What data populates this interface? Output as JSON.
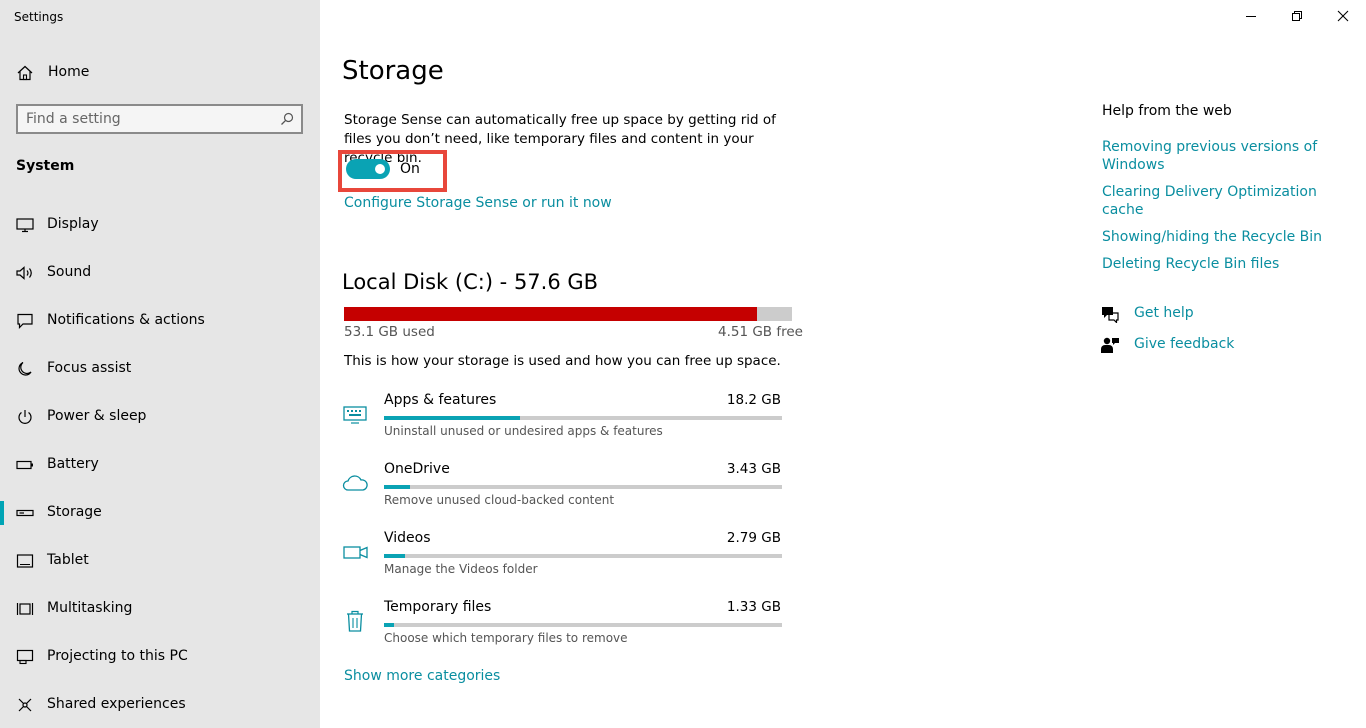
{
  "window": {
    "title": "Settings",
    "controls": [
      {
        "name": "minimize-button",
        "icon": "minimize-icon"
      },
      {
        "name": "restore-button",
        "icon": "restore-icon"
      },
      {
        "name": "close-button",
        "icon": "close-icon"
      }
    ]
  },
  "sidebar": {
    "home_label": "Home",
    "search_placeholder": "Find a setting",
    "section_label": "System",
    "items": [
      {
        "label": "Display",
        "icon": "monitor-icon",
        "active": false
      },
      {
        "label": "Sound",
        "icon": "speaker-icon",
        "active": false
      },
      {
        "label": "Notifications & actions",
        "icon": "notification-icon",
        "active": false
      },
      {
        "label": "Focus assist",
        "icon": "moon-icon",
        "active": false
      },
      {
        "label": "Power & sleep",
        "icon": "power-icon",
        "active": false
      },
      {
        "label": "Battery",
        "icon": "battery-icon",
        "active": false
      },
      {
        "label": "Storage",
        "icon": "storage-icon",
        "active": true
      },
      {
        "label": "Tablet",
        "icon": "tablet-icon",
        "active": false
      },
      {
        "label": "Multitasking",
        "icon": "multitasking-icon",
        "active": false
      },
      {
        "label": "Projecting to this PC",
        "icon": "projector-icon",
        "active": false
      },
      {
        "label": "Shared experiences",
        "icon": "share-icon",
        "active": false
      }
    ]
  },
  "main": {
    "title": "Storage",
    "description": "Storage Sense can automatically free up space by getting rid of files you don’t need, like temporary files and content in your recycle bin.",
    "toggle": {
      "label": "On",
      "state": true
    },
    "configure_link": "Configure Storage Sense or run it now",
    "disk": {
      "title": "Local Disk (C:) - 57.6 GB",
      "used_label": "53.1 GB used",
      "free_label": "4.51 GB free",
      "used_fraction": 0.922
    },
    "usage_description": "This is how your storage is used and how you can free up space.",
    "categories": [
      {
        "name": "Apps & features",
        "size": "18.2 GB",
        "description": "Uninstall unused or undesired apps & features",
        "icon": "keyboard-icon",
        "fraction": 0.341
      },
      {
        "name": "OneDrive",
        "size": "3.43 GB",
        "description": "Remove unused cloud-backed content",
        "icon": "cloud-icon",
        "fraction": 0.065
      },
      {
        "name": "Videos",
        "size": "2.79 GB",
        "description": "Manage the Videos folder",
        "icon": "video-camera-icon",
        "fraction": 0.053
      },
      {
        "name": "Temporary files",
        "size": "1.33 GB",
        "description": "Choose which temporary files to remove",
        "icon": "trash-icon",
        "fraction": 0.025
      }
    ],
    "show_more_link": "Show more categories"
  },
  "help": {
    "heading": "Help from the web",
    "links": [
      "Removing previous versions of Windows",
      "Clearing Delivery Optimization cache",
      "Showing/hiding the Recycle Bin",
      "Deleting Recycle Bin files"
    ],
    "get_help": "Get help",
    "give_feedback": "Give feedback"
  },
  "colors": {
    "accent": "#0aa3b4",
    "link": "#0a8ea0",
    "disk_used": "#c50000",
    "sidebar_bg": "#e6e6e6",
    "highlight_box": "#e8473b"
  }
}
